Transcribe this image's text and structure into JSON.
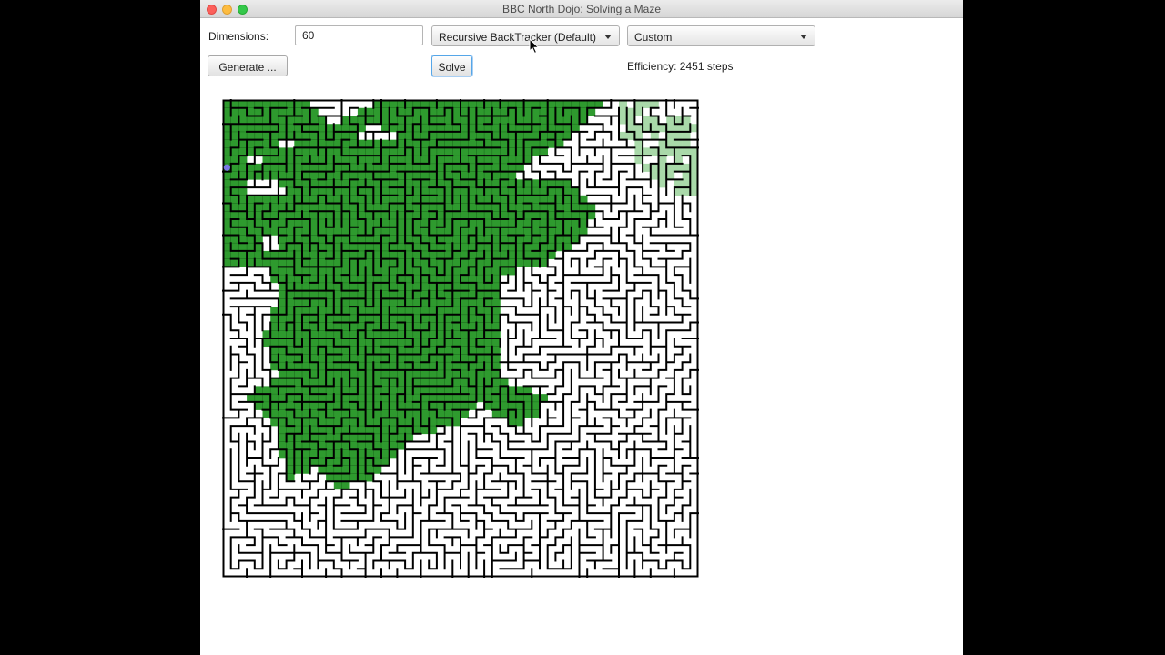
{
  "window": {
    "title": "BBC North Dojo: Solving a Maze"
  },
  "controls": {
    "dimensions_label": "Dimensions:",
    "dimensions_value": "60",
    "generator_selected": "Recursive BackTracker (Default)",
    "solver_selected": "Custom",
    "generate_label": "Generate ...",
    "solve_label": "Solve",
    "efficiency_text": "Efficiency: 2451 steps"
  },
  "maze": {
    "grid_size": 60,
    "colors": {
      "visited": "#2e9a2e",
      "trail": "#a9d9a9",
      "wall": "#000000",
      "cell_divider": "#1f6e1f",
      "start_marker": "#7a78e6"
    }
  }
}
